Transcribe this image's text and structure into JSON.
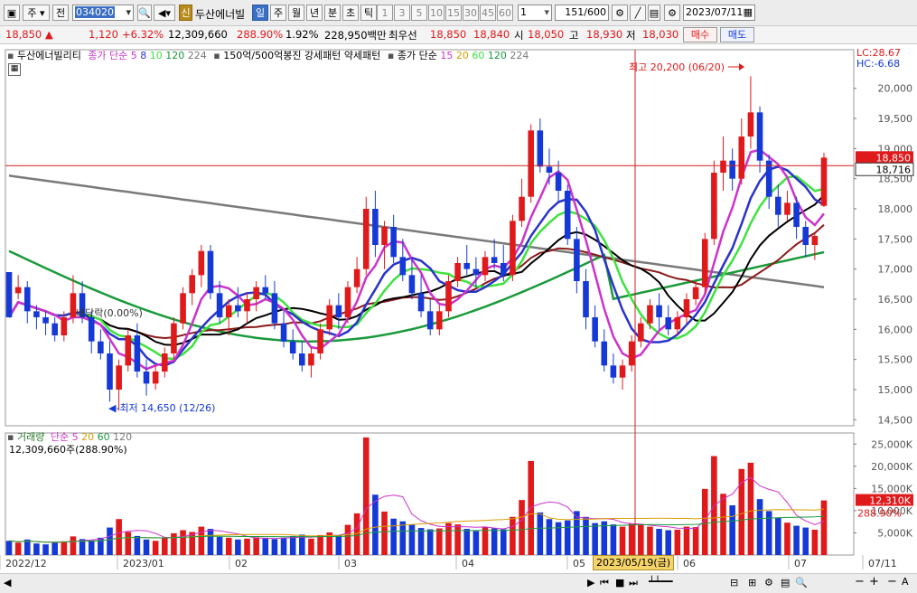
{
  "toolbar": {
    "market_type": "주",
    "prev_label": "전",
    "stock_code": "034020",
    "sin_badge": "신",
    "stock_name": "두산에너빌",
    "period_buttons": [
      "일",
      "주",
      "월",
      "년",
      "분",
      "초",
      "틱"
    ],
    "period_selected": "일",
    "interval_buttons": [
      "1",
      "3",
      "5",
      "10",
      "15",
      "30",
      "45",
      "60"
    ],
    "count_value": "1",
    "page_count": "151",
    "page_total": "/600",
    "date_value": "2023/07/11"
  },
  "quote": {
    "price": "18,850",
    "change": "1,120",
    "change_pct": "+6.32%",
    "volume": "12,309,660",
    "volume_ratio": "288.90%",
    "turnover": "1.92%",
    "amount": "228,950백만",
    "best_label": "최우선",
    "best_ask": "18,850",
    "best_bid": "18,840",
    "open_label": "시",
    "open": "18,050",
    "high_label": "고",
    "high": "18,930",
    "low_label": "저",
    "low": "18,030",
    "buy_label": "매수",
    "sell_label": "매도"
  },
  "legend": {
    "stock": "두산에너빌리티",
    "ma_prefix": "종가 단순",
    "ma_periods": [
      "5",
      "8",
      "10",
      "120",
      "224"
    ],
    "pattern_text": "150억/500억봉진 강세패턴  약세패턴",
    "ma2_prefix": "종가 단순",
    "ma2_periods": [
      "15",
      "20",
      "60",
      "120",
      "224"
    ],
    "lc": "LC:28.67",
    "hc": "HC:-6.68",
    "volume_title": "거래량",
    "vol_ma_prefix": "단순",
    "vol_ma_periods": [
      "5",
      "20",
      "60",
      "120"
    ],
    "volume_info": "12,309,660주(288.90%)"
  },
  "annotations": {
    "high_note": "최고 20,200 (06/20)",
    "low_note": "최저 14,650 (12/26)",
    "ex_div": "배당락(0.00%)",
    "cursor_date": "2023/05/19(금)",
    "price_tag_1": "18,850",
    "price_tag_2": "18,716",
    "vol_tag_1": "12,310K",
    "vol_tag_2": "288.90%"
  },
  "colors": {
    "up": "#e0191b",
    "down": "#1539d6",
    "ma5": "#cc33cc",
    "ma8": "#2a33c9",
    "ma10": "#3ee23e",
    "ma120_short": "#000000",
    "ma224_short": "#8b1a1a",
    "ma_long120": "#1a9a3a",
    "ma_long224": "#7a7a7a"
  },
  "chart_data": {
    "type": "candlestick",
    "price_axis": {
      "ticks": [
        "20,000",
        "19,500",
        "19,000",
        "18,500",
        "18,000",
        "17,500",
        "17,000",
        "16,500",
        "16,000",
        "15,500",
        "15,000",
        "14,500"
      ],
      "tick_values": [
        20000,
        19500,
        19000,
        18500,
        18000,
        17500,
        17000,
        16500,
        16000,
        15500,
        15000,
        14500
      ]
    },
    "volume_axis": {
      "ticks": [
        "25,000K",
        "20,000K",
        "15,000K",
        "10,000K",
        "5,000K"
      ],
      "tick_values": [
        25000,
        20000,
        15000,
        10000,
        5000
      ]
    },
    "x_labels": [
      "2022/12",
      "2023/01",
      "02",
      "03",
      "04",
      "05",
      "06",
      "07",
      "07/11"
    ],
    "ohlc": [
      [
        16950,
        16800,
        16500,
        16200
      ],
      [
        16600,
        16900,
        16500,
        16700
      ],
      [
        16700,
        16800,
        16100,
        16300
      ],
      [
        16300,
        16400,
        16000,
        16200
      ],
      [
        16200,
        16300,
        15900,
        16100
      ],
      [
        16100,
        16200,
        15800,
        15900
      ],
      [
        15900,
        16300,
        15800,
        16200
      ],
      [
        16200,
        16900,
        16100,
        16600
      ],
      [
        16600,
        16800,
        16100,
        16200
      ],
      [
        16200,
        16300,
        15600,
        15800
      ],
      [
        15800,
        16000,
        15500,
        15600
      ],
      [
        15600,
        15800,
        14800,
        15000
      ],
      [
        15000,
        15500,
        14650,
        15400
      ],
      [
        15400,
        16000,
        15300,
        15900
      ],
      [
        15900,
        16100,
        15200,
        15300
      ],
      [
        15300,
        15500,
        14900,
        15100
      ],
      [
        15100,
        15400,
        15000,
        15300
      ],
      [
        15300,
        15700,
        15200,
        15600
      ],
      [
        15600,
        16200,
        15500,
        16100
      ],
      [
        16100,
        16700,
        16000,
        16600
      ],
      [
        16600,
        17000,
        16400,
        16900
      ],
      [
        16900,
        17400,
        16700,
        17300
      ],
      [
        17300,
        17400,
        16500,
        16600
      ],
      [
        16600,
        16800,
        16100,
        16200
      ],
      [
        16200,
        16500,
        15900,
        16400
      ],
      [
        16400,
        16700,
        16200,
        16300
      ],
      [
        16300,
        16600,
        16100,
        16500
      ],
      [
        16500,
        16800,
        16300,
        16700
      ],
      [
        16700,
        16900,
        16500,
        16600
      ],
      [
        16600,
        16800,
        16000,
        16100
      ],
      [
        16100,
        16300,
        15700,
        15800
      ],
      [
        15800,
        16000,
        15500,
        15600
      ],
      [
        15600,
        15800,
        15300,
        15400
      ],
      [
        15400,
        15700,
        15200,
        15600
      ],
      [
        15600,
        16100,
        15500,
        16000
      ],
      [
        16000,
        16500,
        15900,
        16400
      ],
      [
        16400,
        16600,
        16000,
        16200
      ],
      [
        16200,
        16800,
        16100,
        16700
      ],
      [
        16700,
        17200,
        16600,
        17000
      ],
      [
        17000,
        18200,
        16900,
        18000
      ],
      [
        18000,
        18300,
        17200,
        17400
      ],
      [
        17400,
        17800,
        17000,
        17700
      ],
      [
        17700,
        17900,
        17100,
        17200
      ],
      [
        17200,
        17500,
        16800,
        16900
      ],
      [
        16900,
        17200,
        16500,
        16600
      ],
      [
        16600,
        16900,
        16200,
        16300
      ],
      [
        16300,
        16500,
        15900,
        16000
      ],
      [
        16000,
        16400,
        15900,
        16300
      ],
      [
        16300,
        16900,
        16200,
        16800
      ],
      [
        16800,
        17200,
        16700,
        17100
      ],
      [
        17100,
        17400,
        16900,
        17000
      ],
      [
        17000,
        17200,
        16700,
        16900
      ],
      [
        16900,
        17300,
        16800,
        17200
      ],
      [
        17200,
        17500,
        17000,
        17100
      ],
      [
        17100,
        17400,
        16800,
        16900
      ],
      [
        16900,
        17900,
        16800,
        17800
      ],
      [
        17800,
        18500,
        17700,
        18200
      ],
      [
        18200,
        19400,
        18100,
        19300
      ],
      [
        19300,
        19500,
        18600,
        18700
      ],
      [
        18700,
        19000,
        18400,
        18600
      ],
      [
        18600,
        18800,
        18100,
        18300
      ],
      [
        18300,
        18400,
        17400,
        17500
      ],
      [
        17500,
        17700,
        16600,
        16800
      ],
      [
        16800,
        17000,
        16000,
        16200
      ],
      [
        16200,
        16400,
        15700,
        15800
      ],
      [
        15800,
        16000,
        15300,
        15400
      ],
      [
        15400,
        15600,
        15100,
        15200
      ],
      [
        15200,
        15500,
        15000,
        15400
      ],
      [
        15400,
        15900,
        15300,
        15800
      ],
      [
        15800,
        16200,
        15700,
        16100
      ],
      [
        16100,
        16500,
        16000,
        16400
      ],
      [
        16400,
        16600,
        16000,
        16200
      ],
      [
        16200,
        16400,
        15900,
        16000
      ],
      [
        16000,
        16300,
        15900,
        16200
      ],
      [
        16200,
        16600,
        16100,
        16500
      ],
      [
        16500,
        16800,
        16400,
        16700
      ],
      [
        16700,
        17600,
        16600,
        17500
      ],
      [
        17500,
        18800,
        17400,
        18600
      ],
      [
        18600,
        19200,
        18300,
        18800
      ],
      [
        18800,
        19000,
        18300,
        18500
      ],
      [
        18500,
        19500,
        18400,
        19200
      ],
      [
        19200,
        20200,
        19000,
        19600
      ],
      [
        19600,
        19700,
        18600,
        18800
      ],
      [
        18800,
        18900,
        18000,
        18200
      ],
      [
        18200,
        18400,
        17700,
        17900
      ],
      [
        17900,
        18300,
        17800,
        18100
      ],
      [
        18100,
        18200,
        17500,
        17700
      ],
      [
        17700,
        17800,
        17200,
        17400
      ],
      [
        17400,
        17600,
        17150,
        17550
      ],
      [
        18050,
        18930,
        18030,
        18850
      ]
    ],
    "volume": [
      3200,
      2800,
      3500,
      2600,
      2400,
      2900,
      3100,
      4200,
      3600,
      3300,
      3900,
      6200,
      8100,
      5200,
      4300,
      3500,
      3200,
      3800,
      4900,
      5600,
      5200,
      6400,
      5900,
      4100,
      3900,
      3500,
      3700,
      4000,
      3800,
      3600,
      3900,
      4300,
      4600,
      3700,
      4500,
      5100,
      4400,
      6800,
      9400,
      26500,
      13600,
      9800,
      8200,
      7600,
      6900,
      6100,
      5800,
      6000,
      7200,
      6900,
      5900,
      5400,
      6300,
      6000,
      5800,
      8600,
      12400,
      21200,
      9600,
      8100,
      7400,
      7800,
      9900,
      8600,
      7200,
      7600,
      6900,
      6400,
      7100,
      6800,
      6400,
      5900,
      5600,
      5700,
      6400,
      6300,
      14900,
      22300,
      13800,
      11200,
      19400,
      20800,
      12600,
      9900,
      8400,
      7300,
      6600,
      6200,
      5700,
      12310
    ],
    "moving_averages": [
      "종가 단순 5",
      "8",
      "10",
      "120",
      "224",
      "15",
      "20",
      "60"
    ]
  }
}
